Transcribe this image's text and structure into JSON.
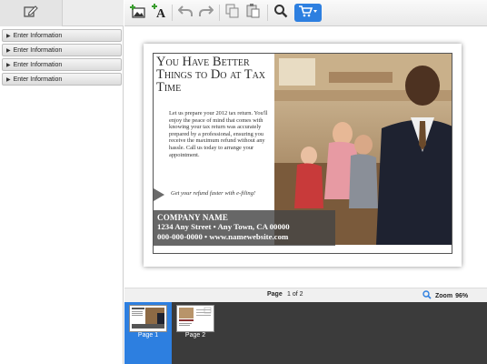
{
  "left_panel": {
    "sections": [
      {
        "label": "Enter Information"
      },
      {
        "label": "Enter Information"
      },
      {
        "label": "Enter Information"
      },
      {
        "label": "Enter Information"
      }
    ]
  },
  "toolbar": {
    "icons": [
      "add-image-icon",
      "add-text-icon",
      "undo-icon",
      "redo-icon",
      "copy-icon",
      "paste-icon",
      "search-icon",
      "cart-icon"
    ],
    "accent_color": "#2d7fe0"
  },
  "card": {
    "headline": "You Have Better Things to Do at Tax Time",
    "body": "Let us prepare your 2012 tax return. You'll enjoy the peace of mind that comes with knowing your tax return was accurately prepared by a professional, ensuring you receive the maximum refund without any hassle. Call us today to arrange your appointment.",
    "refund_line": "Get your refund faster with e-filing!",
    "company_name": "COMPANY NAME",
    "address": "1234 Any Street • Any Town, CA 00000",
    "phone": "000-000-0000 • www.namewebsite.com"
  },
  "status": {
    "page_label": "Page",
    "page_count": "1 of 2",
    "zoom_label": "Zoom",
    "zoom_value": "96%"
  },
  "thumbnails": [
    {
      "label": "Page 1",
      "active": true
    },
    {
      "label": "Page 2",
      "active": false
    }
  ]
}
